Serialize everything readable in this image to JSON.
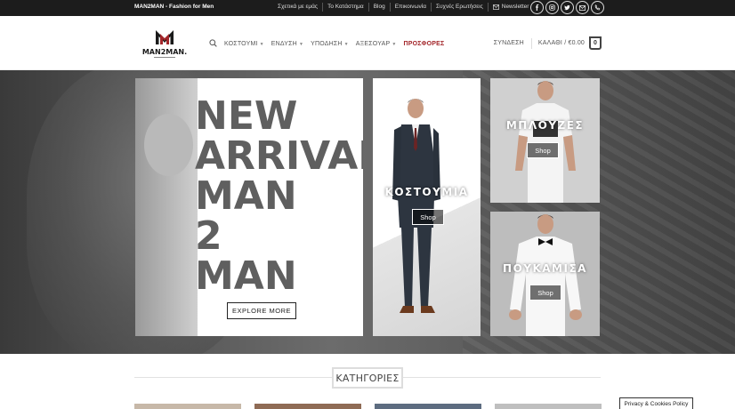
{
  "topbar": {
    "tagline": "MAN2MAN - Fashion for Men",
    "links": [
      "Σχετικά με εμάς",
      "Το Κατάστημα",
      "Blog",
      "Επικοινωνία",
      "Συχνές Ερωτήσεις"
    ],
    "newsletter": "Newsletter",
    "social_icons": [
      "facebook-icon",
      "instagram-icon",
      "twitter-icon",
      "email-icon",
      "phone-icon"
    ]
  },
  "header": {
    "logo_text": "MAN2MAN.",
    "nav": [
      {
        "label": "ΚΟΣΤΟΥΜΙ",
        "has_dropdown": true
      },
      {
        "label": "ΕΝΔΥΣΗ",
        "has_dropdown": true
      },
      {
        "label": "ΥΠΟΔΗΣΗ",
        "has_dropdown": true
      },
      {
        "label": "ΑΞΕΣΟΥΑΡ",
        "has_dropdown": true
      },
      {
        "label": "ΠΡΟΣΦΟΡΕΣ",
        "has_dropdown": false
      }
    ],
    "login": "ΣΥΝΔΕΣΗ",
    "cart_label": "ΚΑΛΑΘΙ / €0.00",
    "cart_count": "0",
    "accent_color": "#a3262a"
  },
  "hero": {
    "headline": [
      "NEW",
      "ARRIVAL",
      "MAN",
      "2",
      "MAN"
    ],
    "explore": "EXPLORE MORE",
    "suits_label": "ΚΟΣΤΟΥΜΙΑ",
    "tshirts_label": "ΜΠΛΟΥΖΕΣ",
    "shirts_label": "ΠΟΥΚΑΜΙΣΑ",
    "shop": "Shop"
  },
  "categories": {
    "title": "ΚΑΤΗΓΟΡΙΕΣ"
  },
  "privacy": "Privacy & Cookies Policy"
}
